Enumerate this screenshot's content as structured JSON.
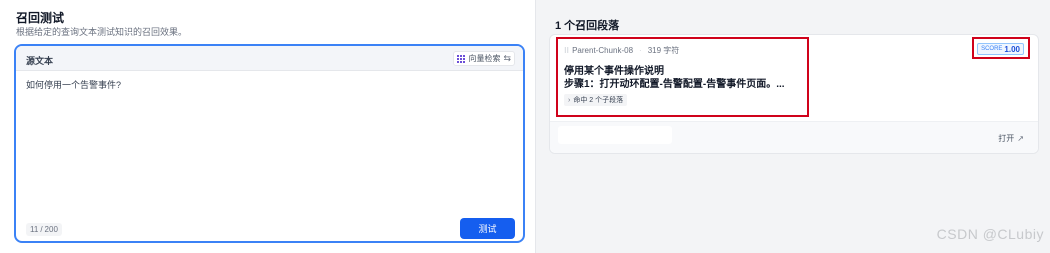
{
  "left": {
    "title": "召回测试",
    "subtitle": "根据给定的查询文本测试知识的召回效果。",
    "source_label": "源文本",
    "search_mode_label": "向量检索",
    "query_text": "如何停用一个告警事件?",
    "char_count": "11",
    "char_limit": "200",
    "test_button": "测试"
  },
  "right": {
    "results_count": "1 个召回段落",
    "result": {
      "chunk_id": "Parent-Chunk-08",
      "char_count": "319 字符",
      "score_label": "SCORE",
      "score_value": "1.00",
      "title": "停用某个事件操作说明",
      "body": "步骤1：打开动环配置-告警配置-告警事件页面。...",
      "child_hits": "命中 2 个子段落",
      "open_label": "打开"
    }
  },
  "watermark": "CSDN @CLubiy",
  "colors": {
    "accent": "#155eef",
    "highlight": "#d0021b",
    "focus_border": "#3b82f6"
  },
  "icons": {
    "search_mode": "vector-grid-icon",
    "toggle": "swap-toggle-icon",
    "chunk": "hash-icon",
    "expand": "chevron-right-icon",
    "open": "arrow-up-right-icon"
  }
}
